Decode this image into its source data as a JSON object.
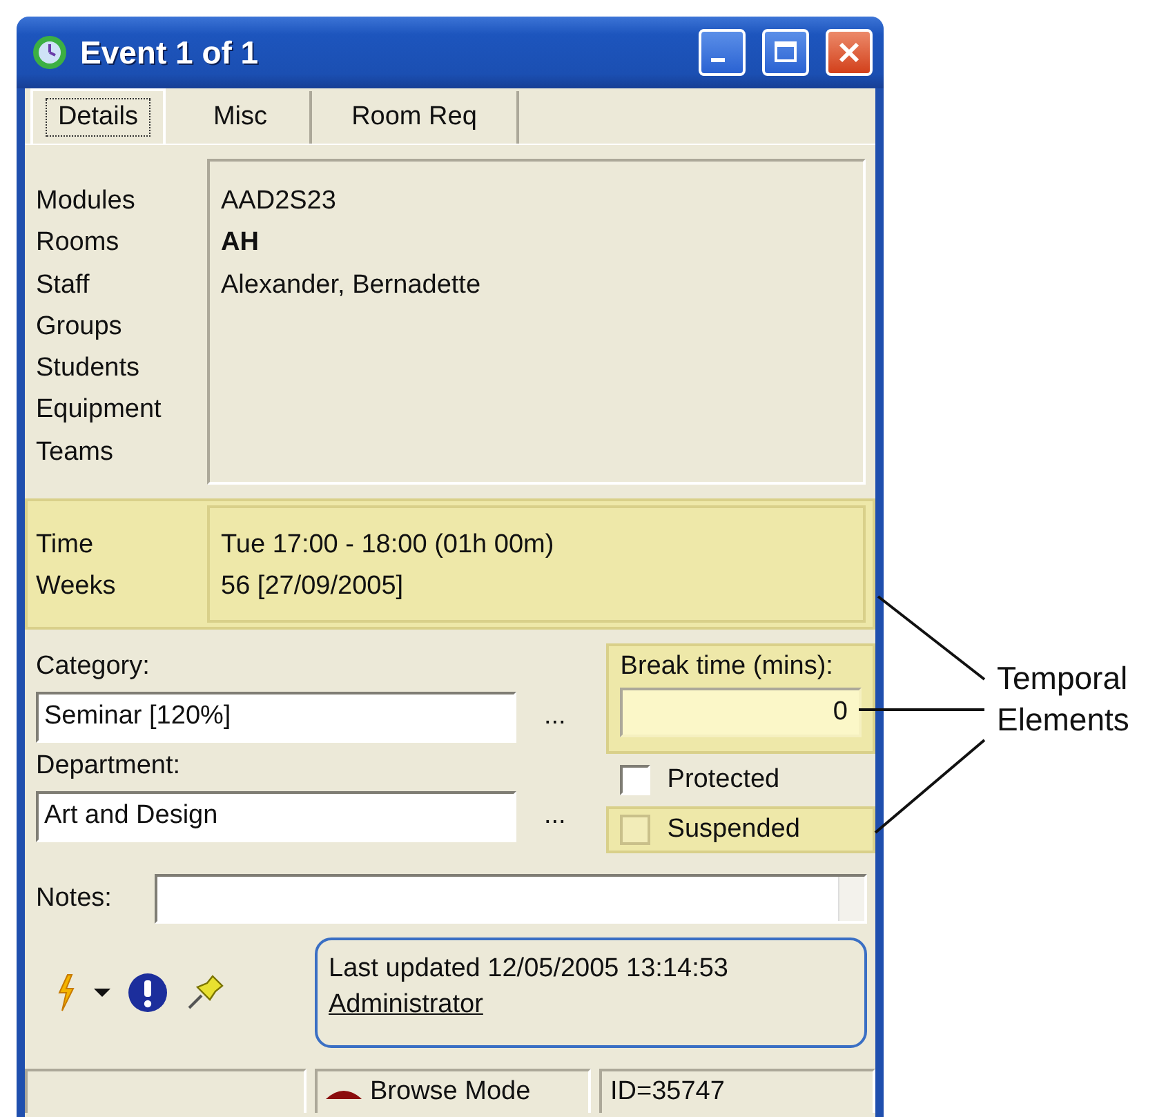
{
  "window": {
    "title": "Event 1 of 1"
  },
  "tabs": [
    {
      "label": "Details",
      "selected": true
    },
    {
      "label": "Misc",
      "selected": false
    },
    {
      "label": "Room Req",
      "selected": false
    }
  ],
  "resources": [
    {
      "label": "Modules",
      "value": "AAD2S23",
      "bold": false
    },
    {
      "label": "Rooms",
      "value": "AH",
      "bold": true
    },
    {
      "label": "Staff",
      "value": "Alexander, Bernadette",
      "bold": false
    },
    {
      "label": "Groups"
    },
    {
      "label": "Students"
    },
    {
      "label": "Equipment"
    },
    {
      "label": "Teams"
    }
  ],
  "timing": [
    {
      "label": "Time",
      "value": "Tue 17:00 - 18:00 (01h 00m)"
    },
    {
      "label": "Weeks",
      "value": "56 [27/09/2005]"
    }
  ],
  "category": {
    "label": "Category:",
    "value": "Seminar [120%]",
    "button": "..."
  },
  "department": {
    "label": "Department:",
    "value": "Art and Design",
    "button": "..."
  },
  "break_time": {
    "label": "Break time (mins):",
    "value": "0"
  },
  "checkboxes": [
    {
      "label": "Protected",
      "checked": false,
      "highlighted": false
    },
    {
      "label": "Suspended",
      "checked": false,
      "highlighted": true
    }
  ],
  "notes": {
    "label": "Notes:"
  },
  "last_updated": {
    "text": "Last updated 12/05/2005 13:14:53",
    "user": "Administrator"
  },
  "status_bar": {
    "mode": "Browse Mode",
    "id": "ID=35747"
  },
  "annotation": {
    "text": "Temporal Elements"
  }
}
